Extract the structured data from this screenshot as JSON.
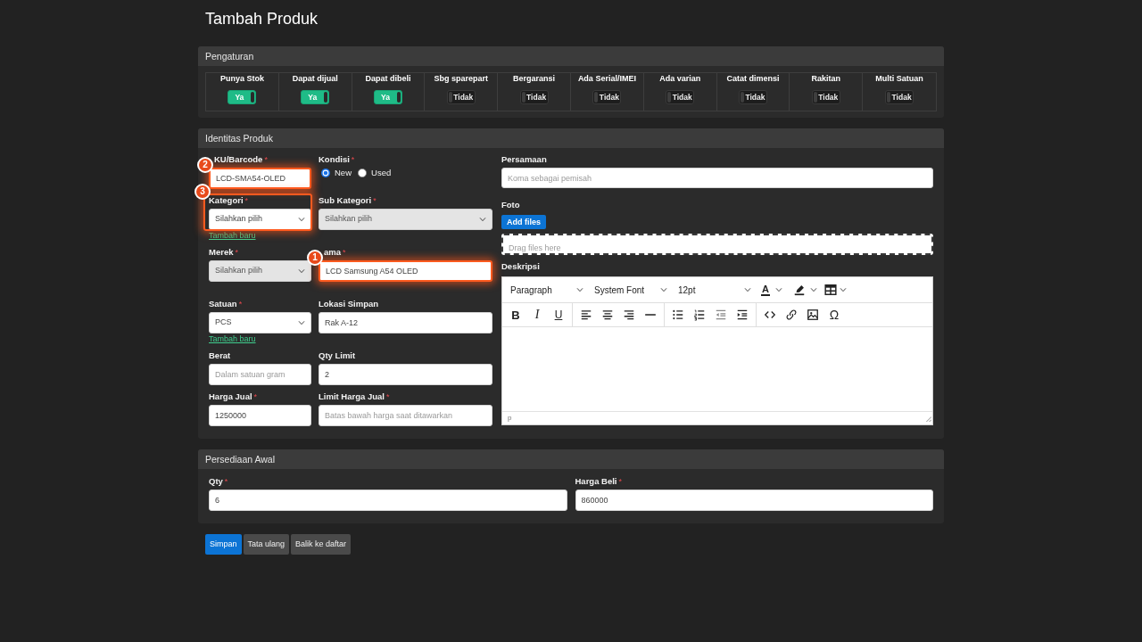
{
  "page_title": "Tambah Produk",
  "settings": {
    "title": "Pengaturan",
    "toggles": [
      {
        "label": "Punya Stok",
        "on": true,
        "text": "Ya"
      },
      {
        "label": "Dapat dijual",
        "on": true,
        "text": "Ya"
      },
      {
        "label": "Dapat dibeli",
        "on": true,
        "text": "Ya"
      },
      {
        "label": "Sbg sparepart",
        "on": false,
        "text": "Tidak"
      },
      {
        "label": "Bergaransi",
        "on": false,
        "text": "Tidak"
      },
      {
        "label": "Ada Serial/IMEI",
        "on": false,
        "text": "Tidak"
      },
      {
        "label": "Ada varian",
        "on": false,
        "text": "Tidak"
      },
      {
        "label": "Catat dimensi",
        "on": false,
        "text": "Tidak"
      },
      {
        "label": "Rakitan",
        "on": false,
        "text": "Tidak"
      },
      {
        "label": "Multi Satuan",
        "on": false,
        "text": "Tidak"
      }
    ]
  },
  "identity": {
    "title": "Identitas Produk",
    "rows": [
      [
        {
          "kind": "text",
          "label": "KU/Barcode",
          "required_mark": "*",
          "value": "LCD-SMA54-OLED",
          "callout": {
            "number": "2",
            "kind": "input"
          }
        },
        {
          "kind": "radio",
          "label": "Kondisi",
          "required_mark": "*",
          "options": [
            {
              "label": "New",
              "selected": true
            },
            {
              "label": "Used",
              "selected": false
            }
          ]
        }
      ],
      [
        {
          "kind": "select",
          "label": "Kategori",
          "required_mark": "*",
          "value": "Silahkan pilih",
          "disabled": false,
          "link": "Tambah baru",
          "callout": {
            "number": "3",
            "kind": "group"
          }
        },
        {
          "kind": "select",
          "label": "Sub Kategori",
          "required_mark": "*",
          "value": "Silahkan pilih",
          "disabled": true
        }
      ],
      [
        {
          "kind": "select",
          "label": "Merek",
          "required_mark": "*",
          "value": "Silahkan pilih",
          "disabled": true
        },
        {
          "kind": "text",
          "label": "ama",
          "required_mark": "*",
          "value": "LCD Samsung A54 OLED",
          "callout": {
            "number": "1",
            "kind": "input"
          }
        }
      ],
      [
        {
          "kind": "select",
          "label": "Satuan",
          "required_mark": "*",
          "value": "PCS",
          "disabled": false,
          "link": "Tambah baru"
        },
        {
          "kind": "text",
          "label": "Lokasi Simpan",
          "value": "Rak A-12"
        }
      ],
      [
        {
          "kind": "text",
          "label": "Berat",
          "placeholder": "Dalam satuan gram"
        },
        {
          "kind": "text",
          "label": "Qty Limit",
          "value": "2"
        }
      ],
      [
        {
          "kind": "text",
          "label": "Harga Jual",
          "required_mark": "*",
          "value": "1250000"
        },
        {
          "kind": "text",
          "label": "Limit Harga Jual",
          "required_mark": "*",
          "placeholder": "Batas bawah harga saat ditawarkan"
        }
      ]
    ],
    "equivalents": {
      "label": "Persamaan",
      "placeholder": "Koma sebagai pemisah"
    },
    "photo": {
      "label": "Foto",
      "button": "Add files",
      "dropzone": "Drag files here"
    },
    "description": {
      "label": "Deskripsi",
      "editor": {
        "block_format": "Paragraph",
        "font_family": "System Font",
        "font_size": "12pt",
        "text_color_glyph": "A",
        "bold_glyph": "B",
        "italic_glyph": "I",
        "underline_glyph": "U",
        "special_char_glyph": "Ω",
        "status_path": "p"
      }
    }
  },
  "initial_stock": {
    "title": "Persediaan Awal",
    "fields": [
      {
        "label": "Qty",
        "required_mark": "*",
        "value": "6"
      },
      {
        "label": "Harga Beli",
        "required_mark": "*",
        "value": "860000"
      }
    ]
  },
  "actions": [
    {
      "label": "Simpan",
      "kind": "primary"
    },
    {
      "label": "Tata ulang",
      "kind": "secondary"
    },
    {
      "label": "Balik ke daftar",
      "kind": "secondary"
    }
  ]
}
